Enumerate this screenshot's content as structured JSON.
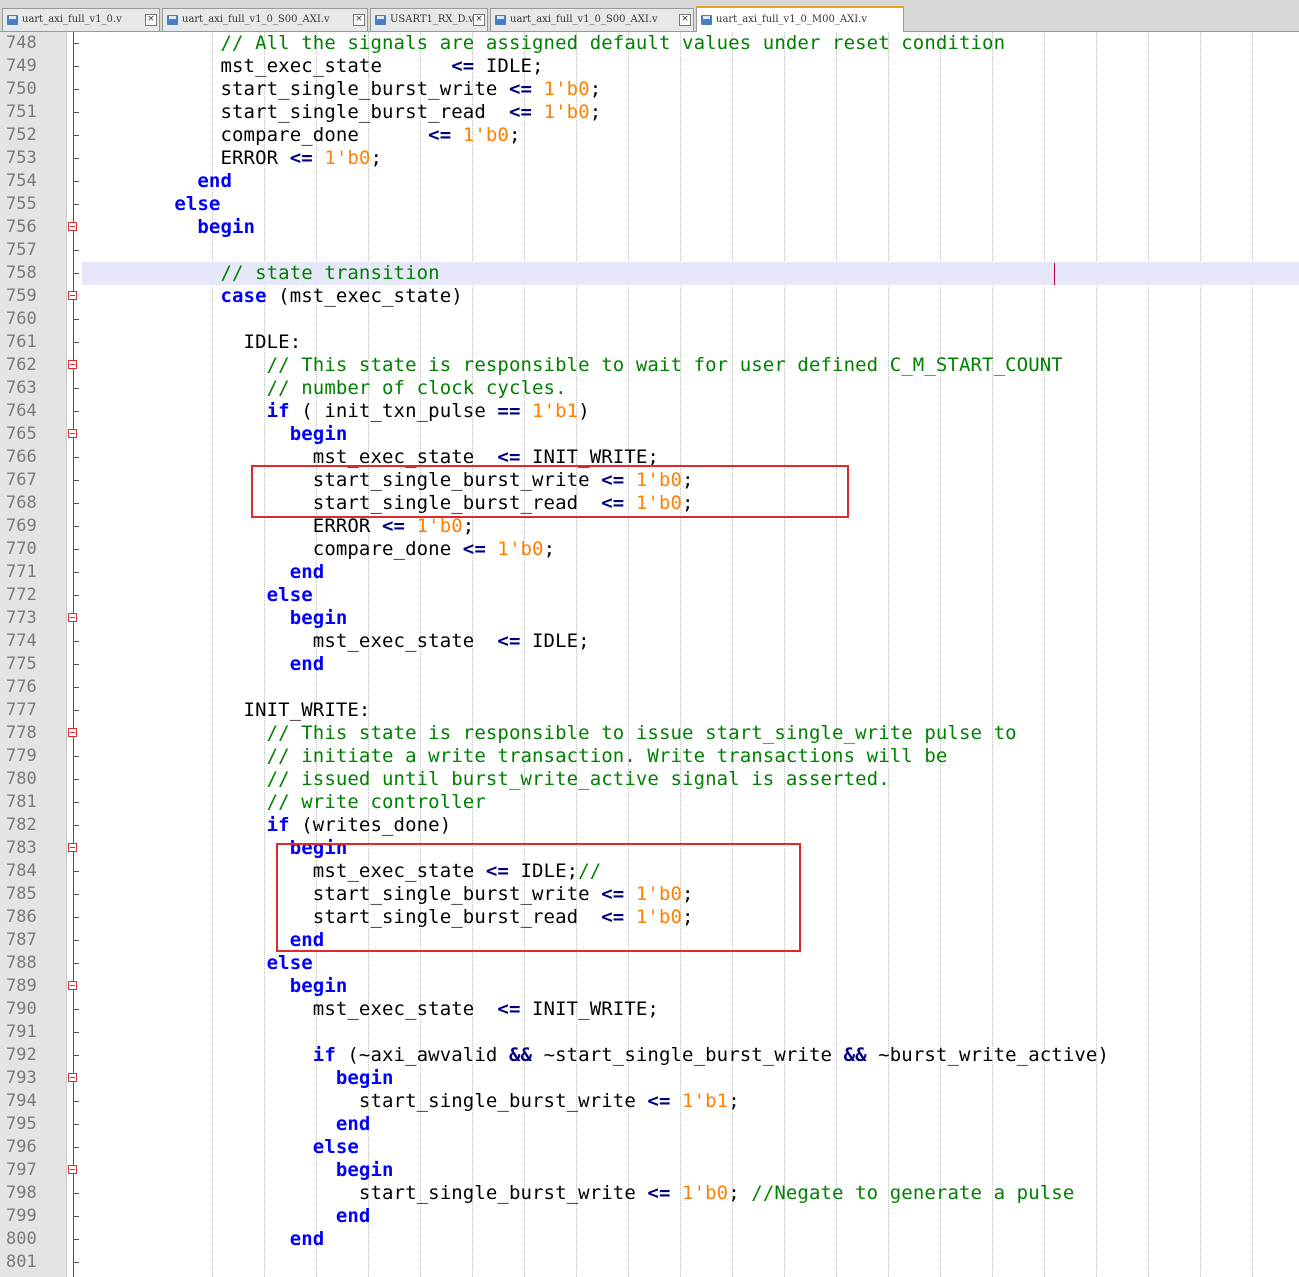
{
  "tabs": [
    {
      "label": "uart_axi_full_v1_0.v",
      "active": false,
      "icon": "file-icon"
    },
    {
      "label": "uart_axi_full_v1_0_S00_AXI.v",
      "active": false,
      "icon": "file-icon"
    },
    {
      "label": "USART1_RX_D.v",
      "active": false,
      "icon": "file-icon"
    },
    {
      "label": "uart_axi_full_v1_0_S00_AXI.v",
      "active": false,
      "icon": "file-icon"
    },
    {
      "label": "uart_axi_full_v1_0_M00_AXI.v",
      "active": true,
      "icon": "file-icon"
    }
  ],
  "colors": {
    "keyword": "#0000ff",
    "comment": "#008000",
    "number": "#ff8000",
    "operator": "#000080",
    "highlight_box": "#e0282e",
    "current_line": "#e6e8fa"
  },
  "editor": {
    "current_line": 758,
    "lines": [
      {
        "n": "748",
        "fold": false,
        "tokens": [
          [
            "",
            "            "
          ],
          [
            "cm",
            "// All the signals are assigned default values under reset condition"
          ]
        ]
      },
      {
        "n": "749",
        "fold": false,
        "tokens": [
          [
            "",
            "            mst_exec_state      "
          ],
          [
            "op",
            "<="
          ],
          [
            "",
            " IDLE;"
          ]
        ]
      },
      {
        "n": "750",
        "fold": false,
        "tokens": [
          [
            "",
            "            start_single_burst_write "
          ],
          [
            "op",
            "<="
          ],
          [
            "",
            " "
          ],
          [
            "num",
            "1'b0"
          ],
          [
            "",
            ";"
          ]
        ]
      },
      {
        "n": "751",
        "fold": false,
        "tokens": [
          [
            "",
            "            start_single_burst_read  "
          ],
          [
            "op",
            "<="
          ],
          [
            "",
            " "
          ],
          [
            "num",
            "1'b0"
          ],
          [
            "",
            ";"
          ]
        ]
      },
      {
        "n": "752",
        "fold": false,
        "tokens": [
          [
            "",
            "            compare_done      "
          ],
          [
            "op",
            "<="
          ],
          [
            "",
            " "
          ],
          [
            "num",
            "1'b0"
          ],
          [
            "",
            ";"
          ]
        ]
      },
      {
        "n": "753",
        "fold": false,
        "tokens": [
          [
            "",
            "            ERROR "
          ],
          [
            "op",
            "<="
          ],
          [
            "",
            " "
          ],
          [
            "num",
            "1'b0"
          ],
          [
            "",
            ";"
          ]
        ]
      },
      {
        "n": "754",
        "fold": false,
        "tokens": [
          [
            "",
            "          "
          ],
          [
            "kw",
            "end"
          ]
        ]
      },
      {
        "n": "755",
        "fold": false,
        "tokens": [
          [
            "",
            "        "
          ],
          [
            "kw",
            "else"
          ]
        ]
      },
      {
        "n": "756",
        "fold": true,
        "tokens": [
          [
            "",
            "          "
          ],
          [
            "kw",
            "begin"
          ]
        ]
      },
      {
        "n": "757",
        "fold": false,
        "tokens": []
      },
      {
        "n": "758",
        "fold": false,
        "tokens": [
          [
            "",
            "            "
          ],
          [
            "cm",
            "// state transition"
          ]
        ]
      },
      {
        "n": "759",
        "fold": true,
        "tokens": [
          [
            "",
            "            "
          ],
          [
            "kw",
            "case"
          ],
          [
            "",
            " (mst_exec_state)"
          ]
        ]
      },
      {
        "n": "760",
        "fold": false,
        "tokens": []
      },
      {
        "n": "761",
        "fold": false,
        "tokens": [
          [
            "",
            "              IDLE:"
          ]
        ]
      },
      {
        "n": "762",
        "fold": true,
        "tokens": [
          [
            "",
            "                "
          ],
          [
            "cm",
            "// This state is responsible to wait for user defined C_M_START_COUNT"
          ]
        ]
      },
      {
        "n": "763",
        "fold": false,
        "tokens": [
          [
            "",
            "                "
          ],
          [
            "cm",
            "// number of clock cycles."
          ]
        ]
      },
      {
        "n": "764",
        "fold": false,
        "tokens": [
          [
            "",
            "                "
          ],
          [
            "kw",
            "if"
          ],
          [
            "",
            " ( init_txn_pulse "
          ],
          [
            "op",
            "=="
          ],
          [
            "",
            " "
          ],
          [
            "num",
            "1'b1"
          ],
          [
            "",
            ")"
          ]
        ]
      },
      {
        "n": "765",
        "fold": true,
        "tokens": [
          [
            "",
            "                  "
          ],
          [
            "kw",
            "begin"
          ]
        ]
      },
      {
        "n": "766",
        "fold": false,
        "tokens": [
          [
            "",
            "                    mst_exec_state  "
          ],
          [
            "op",
            "<="
          ],
          [
            "",
            " INIT_WRITE;"
          ]
        ]
      },
      {
        "n": "767",
        "fold": false,
        "tokens": [
          [
            "",
            "                    start_single_burst_write "
          ],
          [
            "op",
            "<="
          ],
          [
            "",
            " "
          ],
          [
            "num",
            "1'b0"
          ],
          [
            "",
            ";"
          ]
        ]
      },
      {
        "n": "768",
        "fold": false,
        "tokens": [
          [
            "",
            "                    start_single_burst_read  "
          ],
          [
            "op",
            "<="
          ],
          [
            "",
            " "
          ],
          [
            "num",
            "1'b0"
          ],
          [
            "",
            ";"
          ]
        ]
      },
      {
        "n": "769",
        "fold": false,
        "tokens": [
          [
            "",
            "                    ERROR "
          ],
          [
            "op",
            "<="
          ],
          [
            "",
            " "
          ],
          [
            "num",
            "1'b0"
          ],
          [
            "",
            ";"
          ]
        ]
      },
      {
        "n": "770",
        "fold": false,
        "tokens": [
          [
            "",
            "                    compare_done "
          ],
          [
            "op",
            "<="
          ],
          [
            "",
            " "
          ],
          [
            "num",
            "1'b0"
          ],
          [
            "",
            ";"
          ]
        ]
      },
      {
        "n": "771",
        "fold": false,
        "tokens": [
          [
            "",
            "                  "
          ],
          [
            "kw",
            "end"
          ]
        ]
      },
      {
        "n": "772",
        "fold": false,
        "tokens": [
          [
            "",
            "                "
          ],
          [
            "kw",
            "else"
          ]
        ]
      },
      {
        "n": "773",
        "fold": true,
        "tokens": [
          [
            "",
            "                  "
          ],
          [
            "kw",
            "begin"
          ]
        ]
      },
      {
        "n": "774",
        "fold": false,
        "tokens": [
          [
            "",
            "                    mst_exec_state  "
          ],
          [
            "op",
            "<="
          ],
          [
            "",
            " IDLE;"
          ]
        ]
      },
      {
        "n": "775",
        "fold": false,
        "tokens": [
          [
            "",
            "                  "
          ],
          [
            "kw",
            "end"
          ]
        ]
      },
      {
        "n": "776",
        "fold": false,
        "tokens": []
      },
      {
        "n": "777",
        "fold": false,
        "tokens": [
          [
            "",
            "              INIT_WRITE:"
          ]
        ]
      },
      {
        "n": "778",
        "fold": true,
        "tokens": [
          [
            "",
            "                "
          ],
          [
            "cm",
            "// This state is responsible to issue start_single_write pulse to"
          ]
        ]
      },
      {
        "n": "779",
        "fold": false,
        "tokens": [
          [
            "",
            "                "
          ],
          [
            "cm",
            "// initiate a write transaction. Write transactions will be"
          ]
        ]
      },
      {
        "n": "780",
        "fold": false,
        "tokens": [
          [
            "",
            "                "
          ],
          [
            "cm",
            "// issued until burst_write_active signal is asserted."
          ]
        ]
      },
      {
        "n": "781",
        "fold": false,
        "tokens": [
          [
            "",
            "                "
          ],
          [
            "cm",
            "// write controller"
          ]
        ]
      },
      {
        "n": "782",
        "fold": false,
        "tokens": [
          [
            "",
            "                "
          ],
          [
            "kw",
            "if"
          ],
          [
            "",
            " (writes_done)"
          ]
        ]
      },
      {
        "n": "783",
        "fold": true,
        "tokens": [
          [
            "",
            "                  "
          ],
          [
            "kw",
            "begin"
          ]
        ]
      },
      {
        "n": "784",
        "fold": false,
        "tokens": [
          [
            "",
            "                    mst_exec_state "
          ],
          [
            "op",
            "<="
          ],
          [
            "",
            " IDLE;"
          ],
          [
            "cm",
            "//"
          ]
        ]
      },
      {
        "n": "785",
        "fold": false,
        "tokens": [
          [
            "",
            "                    start_single_burst_write "
          ],
          [
            "op",
            "<="
          ],
          [
            "",
            " "
          ],
          [
            "num",
            "1'b0"
          ],
          [
            "",
            ";"
          ]
        ]
      },
      {
        "n": "786",
        "fold": false,
        "tokens": [
          [
            "",
            "                    start_single_burst_read  "
          ],
          [
            "op",
            "<="
          ],
          [
            "",
            " "
          ],
          [
            "num",
            "1'b0"
          ],
          [
            "",
            ";"
          ]
        ]
      },
      {
        "n": "787",
        "fold": false,
        "tokens": [
          [
            "",
            "                  "
          ],
          [
            "kw",
            "end"
          ]
        ]
      },
      {
        "n": "788",
        "fold": false,
        "tokens": [
          [
            "",
            "                "
          ],
          [
            "kw",
            "else"
          ]
        ]
      },
      {
        "n": "789",
        "fold": true,
        "tokens": [
          [
            "",
            "                  "
          ],
          [
            "kw",
            "begin"
          ]
        ]
      },
      {
        "n": "790",
        "fold": false,
        "tokens": [
          [
            "",
            "                    mst_exec_state  "
          ],
          [
            "op",
            "<="
          ],
          [
            "",
            " INIT_WRITE;"
          ]
        ]
      },
      {
        "n": "791",
        "fold": false,
        "tokens": []
      },
      {
        "n": "792",
        "fold": false,
        "tokens": [
          [
            "",
            "                    "
          ],
          [
            "kw",
            "if"
          ],
          [
            "",
            " (~axi_awvalid "
          ],
          [
            "op",
            "&&"
          ],
          [
            "",
            " ~start_single_burst_write "
          ],
          [
            "op",
            "&&"
          ],
          [
            "",
            " ~burst_write_active)"
          ]
        ]
      },
      {
        "n": "793",
        "fold": true,
        "tokens": [
          [
            "",
            "                      "
          ],
          [
            "kw",
            "begin"
          ]
        ]
      },
      {
        "n": "794",
        "fold": false,
        "tokens": [
          [
            "",
            "                        start_single_burst_write "
          ],
          [
            "op",
            "<="
          ],
          [
            "",
            " "
          ],
          [
            "num",
            "1'b1"
          ],
          [
            "",
            ";"
          ]
        ]
      },
      {
        "n": "795",
        "fold": false,
        "tokens": [
          [
            "",
            "                      "
          ],
          [
            "kw",
            "end"
          ]
        ]
      },
      {
        "n": "796",
        "fold": false,
        "tokens": [
          [
            "",
            "                    "
          ],
          [
            "kw",
            "else"
          ]
        ]
      },
      {
        "n": "797",
        "fold": true,
        "tokens": [
          [
            "",
            "                      "
          ],
          [
            "kw",
            "begin"
          ]
        ]
      },
      {
        "n": "798",
        "fold": false,
        "tokens": [
          [
            "",
            "                        start_single_burst_write "
          ],
          [
            "op",
            "<="
          ],
          [
            "",
            " "
          ],
          [
            "num",
            "1'b0"
          ],
          [
            "",
            "; "
          ],
          [
            "cm",
            "//Negate to generate a pulse"
          ]
        ]
      },
      {
        "n": "799",
        "fold": false,
        "tokens": [
          [
            "",
            "                      "
          ],
          [
            "kw",
            "end"
          ]
        ]
      },
      {
        "n": "800",
        "fold": false,
        "tokens": [
          [
            "",
            "                  "
          ],
          [
            "kw",
            "end"
          ]
        ]
      },
      {
        "n": "801",
        "fold": false,
        "tokens": []
      }
    ]
  }
}
